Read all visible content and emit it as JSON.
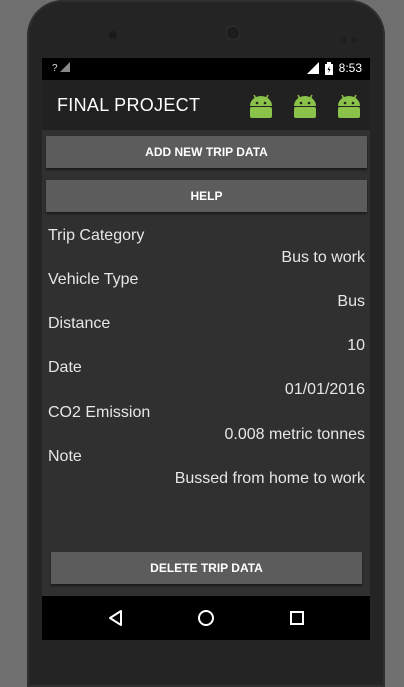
{
  "status": {
    "signal_label": "?",
    "time": "8:53"
  },
  "actionbar": {
    "title": "FINAL PROJECT",
    "icons": [
      "android-icon",
      "android-icon",
      "android-icon"
    ]
  },
  "buttons": {
    "add_new": "ADD NEW TRIP DATA",
    "help": "HELP",
    "delete": "DELETE TRIP DATA"
  },
  "fields": [
    {
      "label": "Trip Category",
      "value": "Bus to work"
    },
    {
      "label": "Vehicle Type",
      "value": "Bus"
    },
    {
      "label": "Distance",
      "value": "10"
    },
    {
      "label": "Date",
      "value": "01/01/2016"
    },
    {
      "label": "CO2 Emission",
      "value": "0.008 metric tonnes"
    },
    {
      "label": "Note",
      "value": "Bussed from home to work"
    }
  ],
  "navbar": {
    "icons": [
      "back-icon",
      "home-icon",
      "recents-icon"
    ]
  },
  "colors": {
    "android_green": "#8bc34a",
    "button_bg": "#5c5c5c",
    "screen_bg": "#303030"
  }
}
